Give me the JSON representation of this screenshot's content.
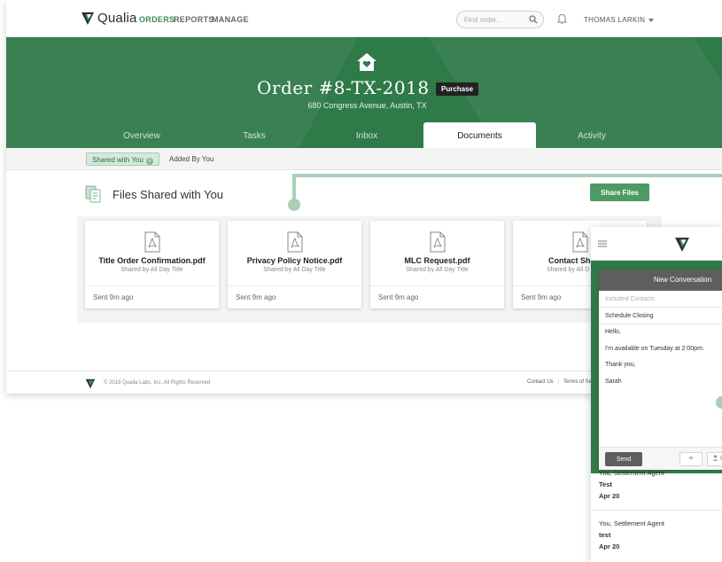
{
  "nav": {
    "brand": "Qualia",
    "links": [
      "ORDERS",
      "REPORTS",
      "MANAGE"
    ],
    "search_placeholder": "Find order...",
    "user": "THOMAS LARKIN"
  },
  "order": {
    "title": "Order #8-TX-2018",
    "badge": "Purchase",
    "address": "680 Congress Avenue, Austin, TX"
  },
  "tabs": [
    "Overview",
    "Tasks",
    "Inbox",
    "Documents",
    "Activity"
  ],
  "active_tab": "Documents",
  "subtabs": [
    "Shared with You",
    "Added By You"
  ],
  "section": {
    "title": "Files Shared with You",
    "share_button": "Share Files"
  },
  "files": [
    {
      "name": "Title Order Confirmation.pdf",
      "by": "Shared by All Day Title",
      "sent": "Sent 9m ago"
    },
    {
      "name": "Privacy Policy Notice.pdf",
      "by": "Shared by All Day Title",
      "sent": "Sent 9m ago"
    },
    {
      "name": "MLC Request.pdf",
      "by": "Shared by All Day Title",
      "sent": "Sent 9m ago"
    },
    {
      "name": "Contact She",
      "by": "Shared by All D",
      "sent": "Sent 9m ago"
    }
  ],
  "footer": {
    "copyright": "© 2018 Qualia Labs, Inc. All Rights Reserved",
    "links": [
      "Contact Us",
      "Terms of Se"
    ]
  },
  "conversation": {
    "header": "New Conversation",
    "contacts_placeholder": "Included Contacts",
    "subject": "Schedule Closing",
    "body": [
      "Hello,",
      "I'm available on Tuesday at 2:00pm.",
      "Thank you,",
      "Sarah"
    ],
    "send_label": "Send",
    "plus_label": "+",
    "upload_label": "U"
  },
  "messages": [
    {
      "from": "You, Settlement Agent",
      "subject": "Test",
      "date": "Apr 20"
    },
    {
      "from": "You, Settlement Agent",
      "subject": "test",
      "date": "Apr 20"
    }
  ],
  "colors": {
    "brand_green": "#2f7a49",
    "button_green": "#4d9b64",
    "accent_light_green": "#a9d0b5"
  }
}
